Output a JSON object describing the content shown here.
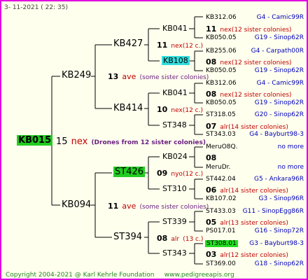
{
  "header": {
    "date": "3- 11-2021 ( 22: 35)"
  },
  "footer": {
    "copyright": "Copyright 2004-2021 @ Karl Kehrle Foundation",
    "site": "www.pedigreeapis.org"
  },
  "root": {
    "code": "KB015",
    "count": "15",
    "mark": "nex",
    "note": "(Drones from 12 sister colonies)"
  },
  "g1": {
    "top": {
      "code": "KB249",
      "count": "13",
      "mark": "ave",
      "note": "(some sister colonies)"
    },
    "bottom": {
      "code": "KB094",
      "count": "11",
      "mark": "ave",
      "note": "(some sister colonies)"
    }
  },
  "g2": [
    {
      "code": "KB427",
      "count": "11",
      "mark": "nex",
      "note": "(12 c.)"
    },
    {
      "code": "KB414",
      "count": "10",
      "mark": "nex",
      "note": "(12 c.)"
    },
    {
      "code": "ST426",
      "count": "09",
      "mark": "nyo",
      "note": "(12 c.)"
    },
    {
      "code": "ST394",
      "count": "08",
      "mark": "alr",
      "note": "(13 c.)"
    }
  ],
  "g3": [
    {
      "code": "KB041",
      "count": "11",
      "mark": "nex",
      "note": "(12 sister colonies)"
    },
    {
      "code": "KB108",
      "count": "08",
      "mark": "nex",
      "note": "(12 sister colonies)"
    },
    {
      "code": "KB041",
      "count": "08",
      "mark": "nex",
      "note": "(12 sister colonies)"
    },
    {
      "code": "ST348",
      "count": "07",
      "mark": "alr",
      "note": "(14 sister colonies)"
    },
    {
      "code": "KB024",
      "count": "08",
      "mark": "",
      "note": ""
    },
    {
      "code": "ST310",
      "count": "06",
      "mark": "alr",
      "note": "(14 sister colonies)"
    },
    {
      "code": "ST339",
      "count": "05",
      "mark": "alr",
      "note": "(13 sister colonies)"
    },
    {
      "code": "ST343",
      "count": "03",
      "mark": "alr",
      "note": "(12 sister colonies)"
    }
  ],
  "g4": [
    {
      "code": "KB312.06",
      "place": "G4 - Camic99R"
    },
    {
      "code": "KB050.05",
      "place": "G19 - Sinop62R"
    },
    {
      "code": "KB255.06",
      "place": "G4 - Carpath00R"
    },
    {
      "code": "KB050.05",
      "place": "G19 - Sinop62R"
    },
    {
      "code": "KB312.06",
      "place": "G4 - Camic99R"
    },
    {
      "code": "KB050.05",
      "place": "G19 - Sinop62R"
    },
    {
      "code": "ST318.05",
      "place": "G20 - Sinop62R"
    },
    {
      "code": "ST343.03",
      "place": "G4 - Bayburt98-3"
    },
    {
      "code": "MeruO8Q.",
      "place": "no more"
    },
    {
      "code": "MeruDr.",
      "place": "no more"
    },
    {
      "code": "ST442.04",
      "place": "G5 - Ankara96R"
    },
    {
      "code": "KB107.02",
      "place": "G3 - Sinop96R"
    },
    {
      "code": "ST433.03",
      "place": "G11 - SinopEgg86R"
    },
    {
      "code": "PS017.01",
      "place": "G16 - Sinop72R"
    },
    {
      "code": "ST308.01",
      "place": "G3 - Bayburt98-3"
    },
    {
      "code": "ST369.00",
      "place": "G18 - Sinop62R"
    }
  ]
}
